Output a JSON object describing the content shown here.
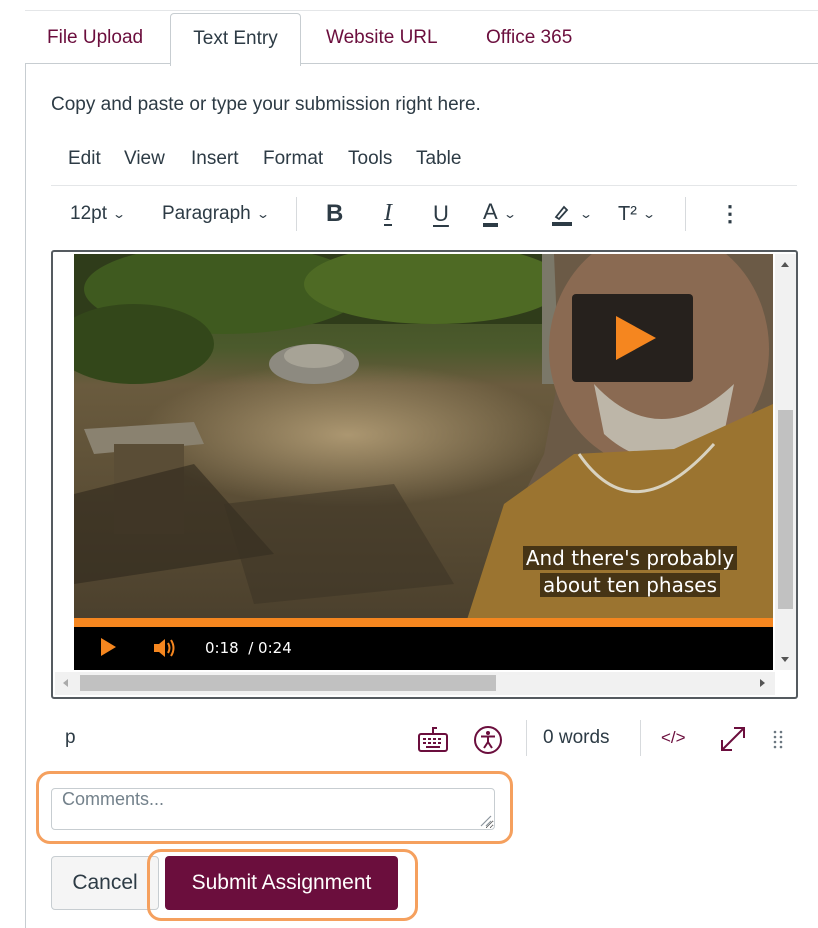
{
  "tabs": [
    {
      "label": "File Upload"
    },
    {
      "label": "Text Entry"
    },
    {
      "label": "Website URL"
    },
    {
      "label": "Office 365"
    }
  ],
  "active_tab": "Text Entry",
  "instructions": "Copy and paste or type your submission right here.",
  "menubar": [
    "Edit",
    "View",
    "Insert",
    "Format",
    "Tools",
    "Table"
  ],
  "toolbar": {
    "font_size": "12pt",
    "block_format": "Paragraph",
    "bold_label": "B",
    "italic_label": "I",
    "underline_label": "U",
    "text_color_label": "A",
    "superscript_label": "T²",
    "more_label": "⋮",
    "icons": [
      "bold-icon",
      "italic-icon",
      "underline-icon",
      "text-color-icon",
      "highlight-icon",
      "superscript-icon",
      "more-icon"
    ]
  },
  "video": {
    "caption_line1": "And there's probably",
    "caption_line2": "about ten phases",
    "current_time": "0:18",
    "duration": "/ 0:24",
    "accent_color": "#f5861f"
  },
  "statusbar": {
    "path": "p",
    "word_count": "0 words",
    "html_toggle": "</>",
    "icons": [
      "keyboard-icon",
      "accessibility-icon",
      "fullscreen-icon",
      "resize-grip-icon"
    ]
  },
  "comments": {
    "placeholder": "Comments..."
  },
  "buttons": {
    "cancel": "Cancel",
    "submit": "Submit Assignment"
  },
  "colors": {
    "brand": "#6b0e3d",
    "highlight": "#f5a05e",
    "text": "#2d3b45"
  }
}
